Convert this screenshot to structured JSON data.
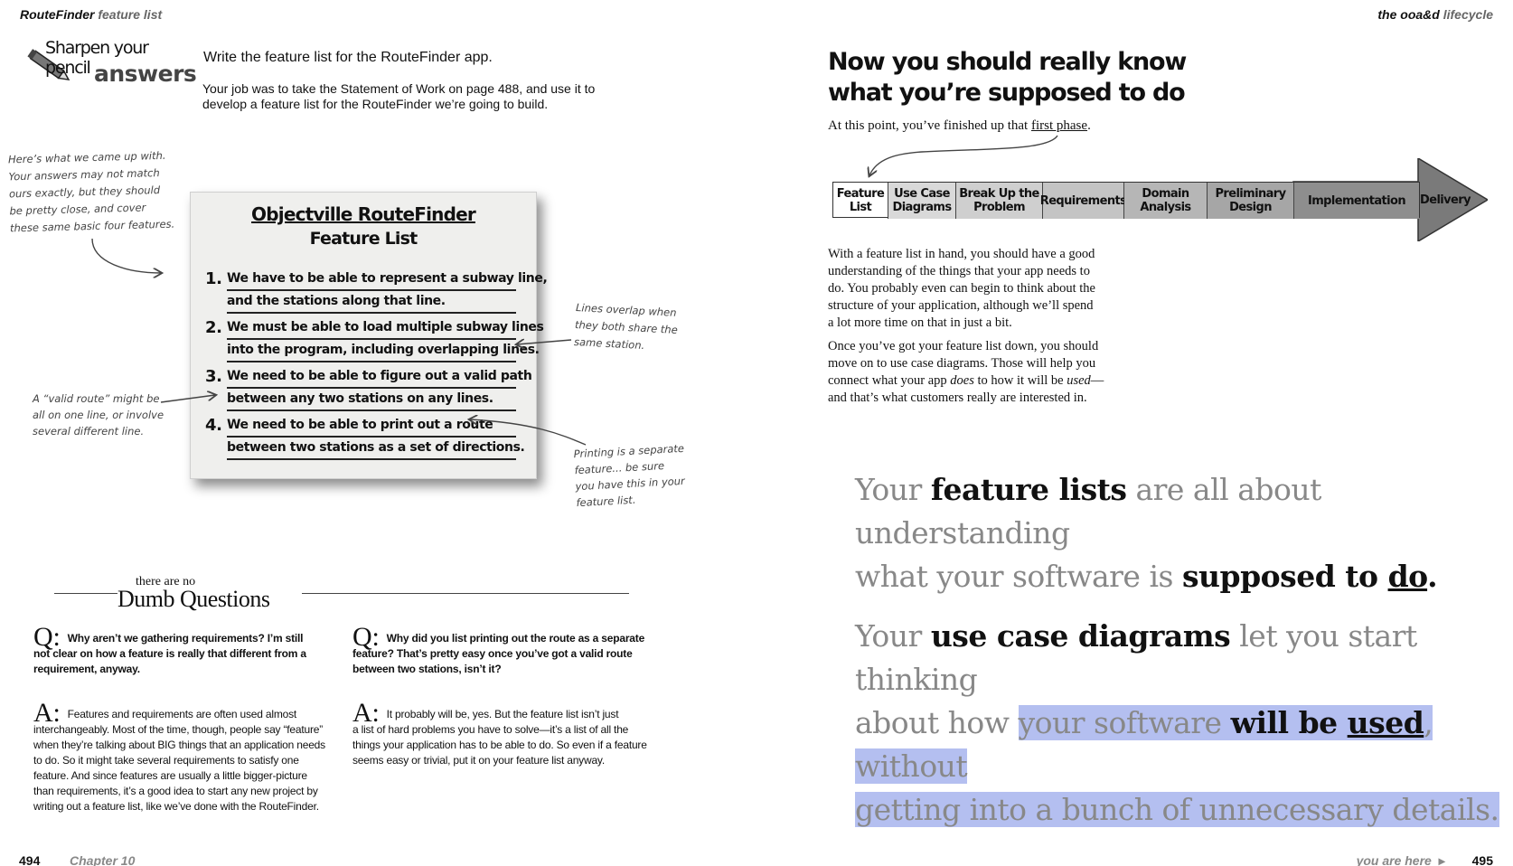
{
  "left_page": {
    "header": {
      "title_bold": "RouteFinder",
      "title_soft": "feature list"
    },
    "sharpen": {
      "line1": "Sharpen your pencil",
      "line2": "answers"
    },
    "task_heading": "Write the feature list for the RouteFinder app.",
    "task_body_1": "Your job was to take the Statement of Work on page 488, and use it to",
    "task_body_2": "develop a feature list for the RouteFinder we’re going to build.",
    "note_top": [
      "Here’s what we came up with.",
      "Your answers may not match",
      "ours exactly, but they should",
      "be pretty close, and cover",
      "these same basic four features."
    ],
    "card": {
      "title": "Objectville RouteFinder",
      "subtitle": "Feature List",
      "items": [
        {
          "num": "1.",
          "lines": [
            "We have to be able to represent a subway line,",
            "and the stations along that line."
          ]
        },
        {
          "num": "2.",
          "lines": [
            "We must be able to load multiple subway lines",
            "into the program, including overlapping lines."
          ]
        },
        {
          "num": "3.",
          "lines": [
            "We need to be able to figure out a valid path",
            "between any two stations on any lines."
          ]
        },
        {
          "num": "4.",
          "lines": [
            "We need to be able to print out a route",
            "between two stations as a set of directions."
          ]
        }
      ]
    },
    "note_overlap": [
      "Lines overlap when",
      "they both share the",
      "same station."
    ],
    "note_valid": [
      "A “valid route” might be",
      "all on one line, or involve",
      "several different line."
    ],
    "note_print": [
      "Printing is a separate",
      "feature... be sure",
      "you have this in your",
      "feature list."
    ],
    "dumb": {
      "small": "there are no",
      "big": "Dumb Questions"
    },
    "q1": {
      "marker": "Q:",
      "lines": [
        "Why aren’t we gathering requirements? I’m still",
        "not clear on how a feature is really that different from a",
        "requirement, anyway."
      ]
    },
    "a1": {
      "marker": "A:",
      "lines": [
        "Features and requirements are often used almost",
        "interchangeably. Most of the time, though, people say “feature”",
        "when they’re talking about BIG things that an application needs",
        "to do. So it might take several requirements to satisfy one",
        "feature. And since features are usually a little bigger-picture",
        "than requirements, it’s a good idea to start any new project by",
        "writing out a feature list, like we’ve done with the RouteFinder."
      ]
    },
    "q2": {
      "marker": "Q:",
      "lines": [
        "Why did you list printing out the route as a separate",
        "feature? That’s pretty easy once you’ve got a valid route",
        "between two stations, isn’t it?"
      ]
    },
    "a2": {
      "marker": "A:",
      "lines": [
        "It probably will be, yes. But the feature list isn’t just",
        "a list of hard problems you have to solve—it’s a list of all the",
        "things your application has to be able to do. So even if a feature",
        "seems easy or trivial, put it on your feature list anyway."
      ]
    },
    "footer": {
      "page": "494",
      "chapter": "Chapter 10"
    }
  },
  "right_page": {
    "header": {
      "title_bold": "the ooa&d",
      "title_soft": "lifecycle"
    },
    "heading_1": "Now you should really know",
    "heading_2": "what you’re supposed to do",
    "intro_before": "At this point, you’ve finished up that ",
    "intro_link": "first phase",
    "intro_after": ".",
    "lifecycle": [
      {
        "label": "Feature List",
        "l1": "Feature",
        "l2": "List",
        "fill": "#ffffff"
      },
      {
        "label": "Use Case Diagrams",
        "l1": "Use Case",
        "l2": "Diagrams",
        "fill": "#d9d9d9"
      },
      {
        "label": "Break Up the Problem",
        "l1": "Break Up the",
        "l2": "Problem",
        "fill": "#cfcfcf"
      },
      {
        "label": "Requirements",
        "l1": "Requirements",
        "l2": "",
        "fill": "#c4c4c4"
      },
      {
        "label": "Domain Analysis",
        "l1": "Domain",
        "l2": "Analysis",
        "fill": "#b6b6b6"
      },
      {
        "label": "Preliminary Design",
        "l1": "Preliminary",
        "l2": "Design",
        "fill": "#a6a6a6"
      },
      {
        "label": "Implementation",
        "l1": "Implementation",
        "l2": "",
        "fill": "#8e8e8e"
      },
      {
        "label": "Delivery",
        "l1": "Delivery",
        "l2": "",
        "fill": "#7a7a7a"
      }
    ],
    "para1": [
      "With a feature list in hand, you should have a good",
      "understanding of the things that your app needs to",
      "do. You probably even can begin to think about the",
      "structure of your application, although we’ll spend",
      "a lot more time on that in just a bit."
    ],
    "para2_l1": "Once you’ve got your feature list down, you should",
    "para2_l2": "move on to use case diagrams. Those will help you",
    "para2_l3a": "connect what your app ",
    "para2_l3b": "does",
    "para2_l3c": " to how it will be ",
    "para2_l3d": "used",
    "para2_l3e": "—",
    "para2_l4": "and that’s what customers really are interested in.",
    "statement1": {
      "a": "Your ",
      "b": "feature lists",
      "c": " are all about understanding",
      "d": "what your software is ",
      "e": "supposed to ",
      "f": "do",
      "g": "."
    },
    "statement2": {
      "a": "Your ",
      "b": "use case diagrams",
      "c": " let you start thinking",
      "d": "about how ",
      "e": "your software ",
      "f": "will be ",
      "g": "used",
      "h": ", without",
      "i": "getting into a bunch of unnecessary details."
    },
    "footer": {
      "here": "you are here",
      "arrow": "▸",
      "page": "495"
    }
  },
  "colors": {
    "highlight": "#b4bff0",
    "soft_text": "#888888",
    "card_bg": "#efefed"
  }
}
